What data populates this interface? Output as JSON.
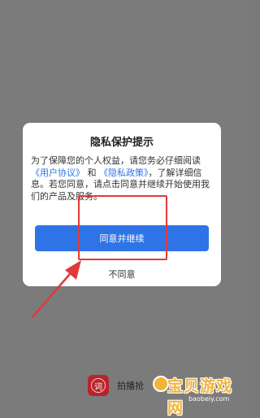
{
  "dialog": {
    "title": "隐私保护提示",
    "body_1": "为了保障您的个人权益，请您务必仔细阅读",
    "link_user_agreement": "《用户协议》",
    "body_and": "和",
    "link_privacy_policy": "《隐私政策》",
    "body_2": "，了解详细信息。若您同意，请点击同意并继续开始使用我们的产品及服务。",
    "agree_button": "同意并继续",
    "decline_link": "不同意"
  },
  "app_bar": {
    "icon_char": "词",
    "app_name": "拍播抢"
  },
  "watermark": {
    "text": "宝贝游戏网",
    "url": "baobeiy.com"
  },
  "colors": {
    "accent": "#2f74e6",
    "annotation_red": "#e03a3a",
    "overlay": "#7b7b7b"
  }
}
